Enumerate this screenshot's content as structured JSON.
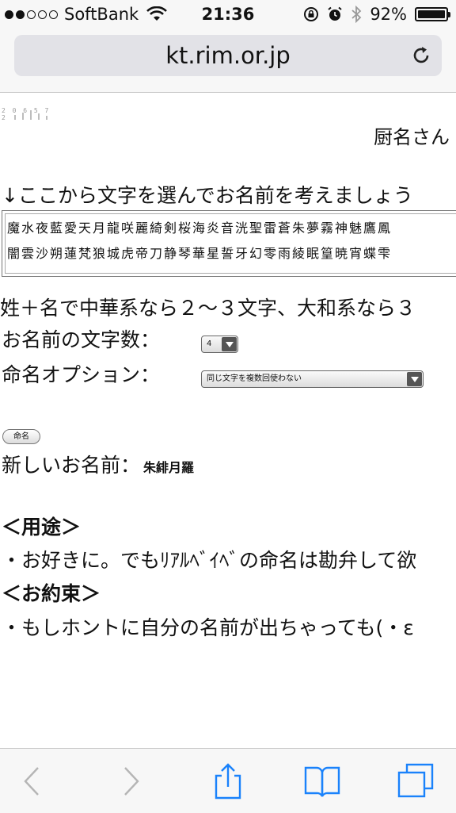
{
  "status_bar": {
    "carrier": "SoftBank",
    "time": "21:36",
    "battery": "92%",
    "signal_bars": 2
  },
  "browser": {
    "url": "kt.rim.or.jp"
  },
  "page": {
    "counter": "2 0 6 5 7 2",
    "author": "厨名さん",
    "intro": "↓ここから文字を選んでお名前を考えましょう",
    "kanji_row1": "魔水夜藍愛天月龍咲麗綺剣桜海炎音洸聖雷蒼朱夢霧神魅鷹鳳",
    "kanji_row2": "闇雲沙朔蓮梵狼城虎帝刀静琴華星誓牙幻零雨綾眠篁暁宵蝶雫",
    "rule": "姓＋名で中華系なら２〜３文字、大和系なら３",
    "count_label": "お名前の文字数：",
    "count_value": "4",
    "option_label": "命名オプション：",
    "option_value": "同じ文字を複数回使わない",
    "name_button": "命名",
    "result_label": "新しいお名前：",
    "result_value": "朱緋月羅",
    "usage_heading": "＜用途＞",
    "usage_text": "・お好きに。でもﾘｱﾙﾍﾞｲﾍﾞの命名は勘弁して欲",
    "promise_heading": "＜お約束＞",
    "promise_text": "・もしホントに自分の名前が出ちゃっても(・ε"
  },
  "toolbar": {
    "icons": [
      "back-icon",
      "forward-icon",
      "share-icon",
      "bookmarks-icon",
      "tabs-icon"
    ]
  },
  "colors": {
    "ios_blue": "#1a82fb",
    "disabled": "#b5b5b5"
  }
}
